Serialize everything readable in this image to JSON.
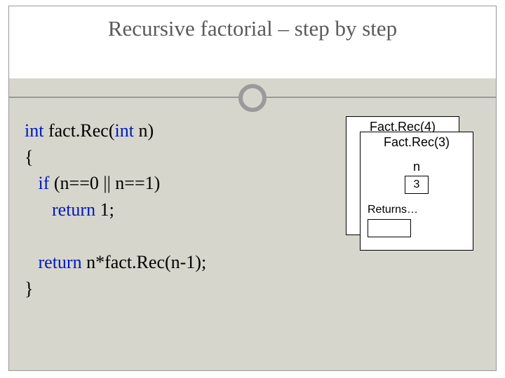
{
  "title": "Recursive factorial – step by step",
  "code": {
    "sig_kw1": "int",
    "sig_name": " fact.Rec(",
    "sig_kw2": "int",
    "sig_rest": " n)",
    "open_brace": "{",
    "if_kw": "if",
    "if_cond": " (n==0 || n==1)",
    "ret1_kw": "return",
    "ret1_rest": " 1;",
    "ret2_kw": "return",
    "ret2_rest": " n*fact.Rec(n-1);",
    "close_brace": "}"
  },
  "stack": {
    "back_title": "Fact.Rec(4)",
    "front_title": "Fact.Rec(3)",
    "var_label": "n",
    "var_value": "3",
    "returns_label": "Returns…",
    "returns_value": ""
  }
}
